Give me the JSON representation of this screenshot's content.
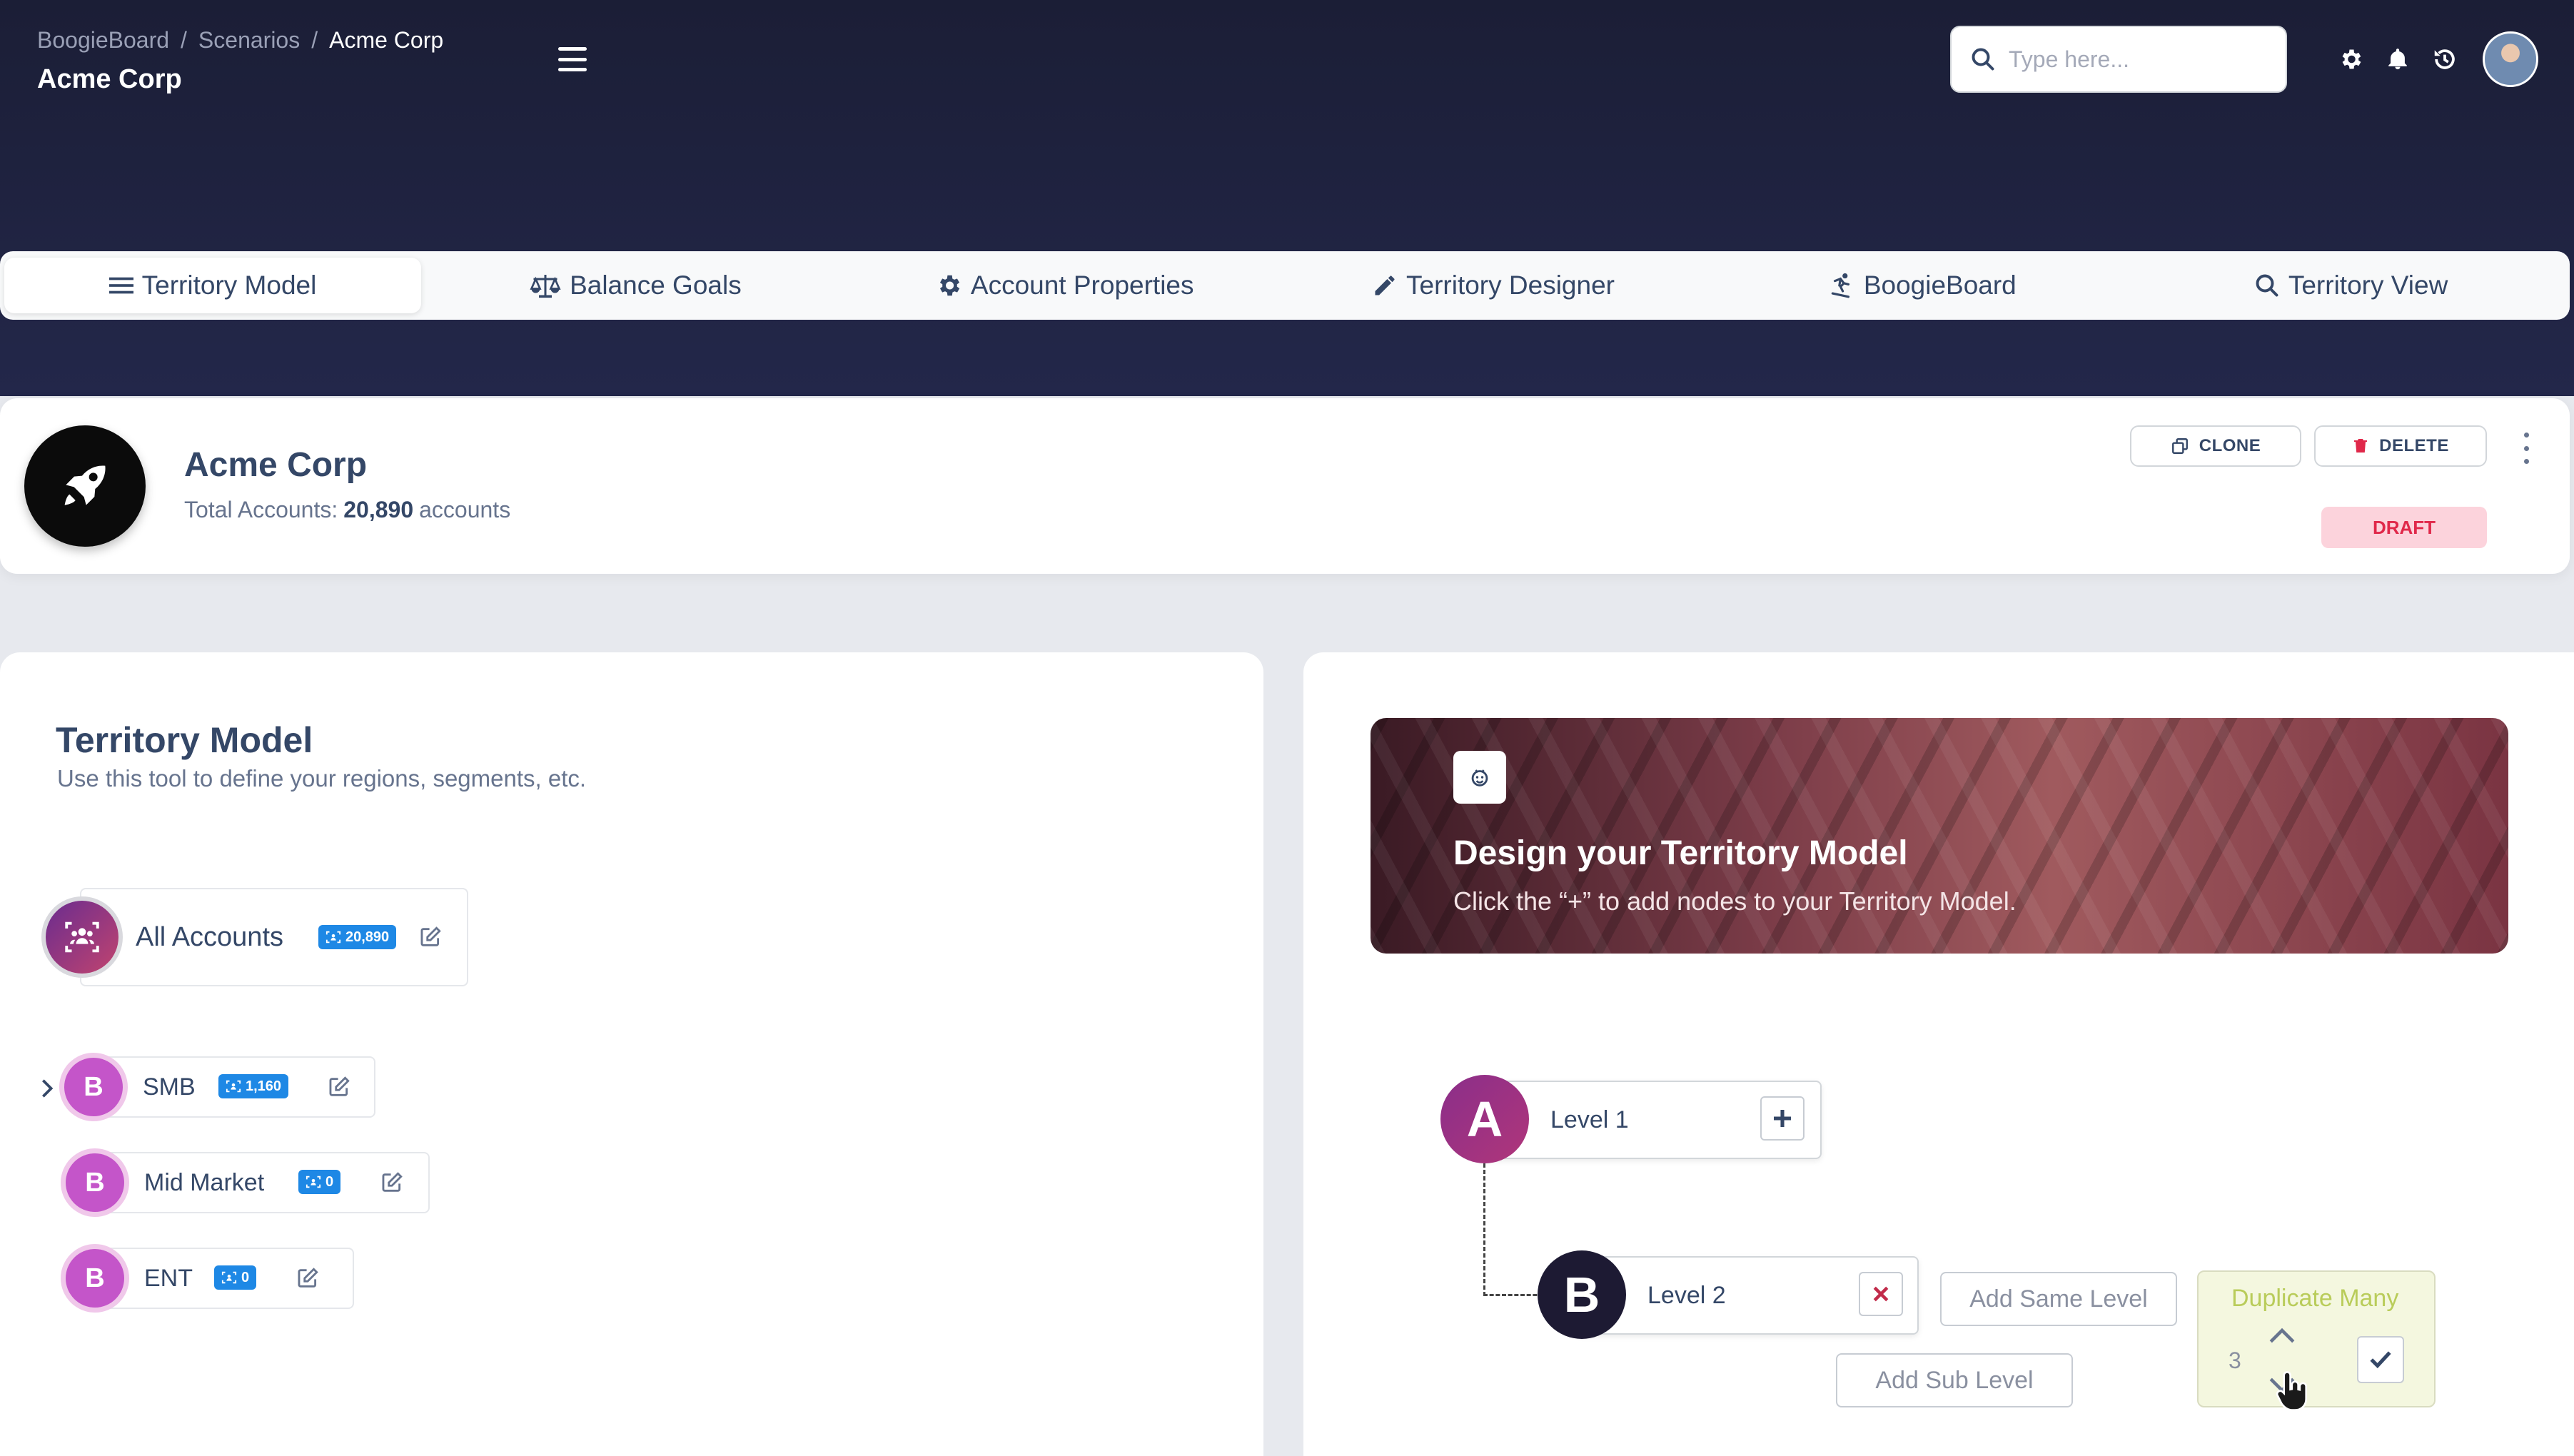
{
  "header": {
    "breadcrumb": [
      "BoogieBoard",
      "Scenarios",
      "Acme Corp"
    ],
    "breadcrumb_sep": "/",
    "page_title": "Acme Corp",
    "search_placeholder": "Type here...",
    "icons": [
      "search-icon",
      "gear-icon",
      "bell-icon",
      "history-icon",
      "user-avatar"
    ]
  },
  "tabs": [
    {
      "label": "Territory Model",
      "icon": "list-icon",
      "active": true
    },
    {
      "label": "Balance Goals",
      "icon": "scale-icon",
      "active": false
    },
    {
      "label": "Account Properties",
      "icon": "gear-icon",
      "active": false
    },
    {
      "label": "Territory Designer",
      "icon": "pencil-icon",
      "active": false
    },
    {
      "label": "BoogieBoard",
      "icon": "snowboarder-icon",
      "active": false
    },
    {
      "label": "Territory View",
      "icon": "search-icon",
      "active": false
    }
  ],
  "scenario": {
    "name": "Acme Corp",
    "total_label": "Total Accounts:",
    "total_value": "20,890",
    "total_unit": "accounts",
    "clone_label": "CLONE",
    "delete_label": "DELETE",
    "status": "DRAFT"
  },
  "territory_model": {
    "title": "Territory Model",
    "subtitle": "Use this tool to define your regions, segments, etc.",
    "root": {
      "label": "All Accounts",
      "count": "20,890"
    },
    "children": [
      {
        "letter": "B",
        "label": "SMB",
        "count": "1,160",
        "expandable": true
      },
      {
        "letter": "B",
        "label": "Mid Market",
        "count": "0",
        "expandable": false
      },
      {
        "letter": "B",
        "label": "ENT",
        "count": "0",
        "expandable": false
      }
    ]
  },
  "designer": {
    "banner_title": "Design your Territory Model",
    "banner_subtitle": "Click the “+” to add nodes to your Territory Model.",
    "level1": {
      "letter": "A",
      "label": "Level 1"
    },
    "level2": {
      "letter": "B",
      "label": "Level 2"
    },
    "add_same_label": "Add Same Level",
    "add_sub_label": "Add Sub Level",
    "duplicate_label": "Duplicate Many",
    "duplicate_value": "3"
  },
  "colors": {
    "hero": "#1b1e36",
    "accent_blue": "#1e88e5",
    "draft_text": "#e0284a",
    "draft_bg": "#fcd3dc",
    "node_b_purple": "#c455c9",
    "node_a_purple": "#8a2e8a",
    "duplicate_text": "#b9cc5a"
  }
}
